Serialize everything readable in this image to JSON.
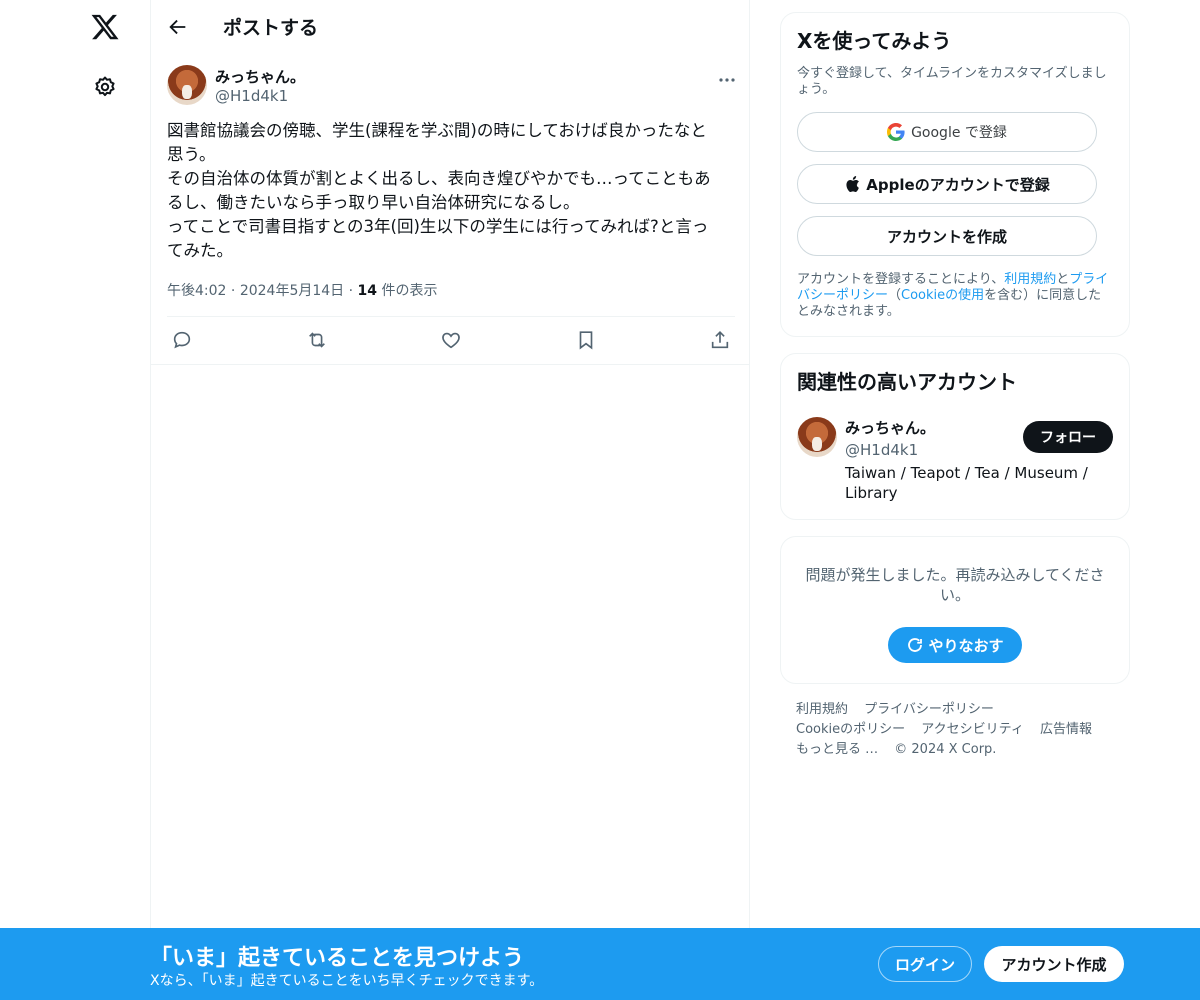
{
  "nav": {
    "logo": "x-logo",
    "settings_icon": "gear-icon"
  },
  "header": {
    "title": "ポストする"
  },
  "post": {
    "author_name": "みっちゃん。",
    "author_handle": "@H1d4k1",
    "text": "図書館協議会の傍聴、学生(課程を学ぶ間)の時にしておけば良かったなと\n思う。\nその自治体の体質が割とよく出るし、表向き煌びやかでも…ってこともあ\nるし、働きたいなら手っ取り早い自治体研究になるし。\nってことで司書目指すとの3年(回)生以下の学生には行ってみれば?と言っ\nてみた。",
    "time": "午後4:02",
    "date": "2024年5月14日",
    "views_count": "14",
    "views_label": "件の表示"
  },
  "signup_card": {
    "title": "Xを使ってみよう",
    "subtitle": "今すぐ登録して、タイムラインをカスタマイズしましょう。",
    "google_label": "Google で登録",
    "apple_label": "Appleのアカウントで登録",
    "create_label": "アカウントを作成",
    "legal_1": "アカウントを登録することにより、",
    "legal_terms": "利用規約",
    "legal_and": "と",
    "legal_privacy": "プライバシーポリシー",
    "legal_paren_open": "（",
    "legal_cookie": "Cookieの使用",
    "legal_2": "を含む）に同意したとみなされます。"
  },
  "related": {
    "title": "関連性の高いアカウント",
    "name": "みっちゃん。",
    "handle": "@H1d4k1",
    "bio": "Taiwan / Teapot / Tea / Museum / Library",
    "follow_label": "フォロー"
  },
  "error_card": {
    "message": "問題が発生しました。再読み込みしてください。",
    "retry_label": "やりなおす"
  },
  "footer": {
    "terms": "利用規約",
    "privacy": "プライバシーポリシー",
    "cookie": "Cookieのポリシー",
    "accessibility": "アクセシビリティ",
    "ads": "広告情報",
    "more": "もっと見る …",
    "copyright": "© 2024 X Corp."
  },
  "banner": {
    "title": "「いま」起きていることを見つけよう",
    "subtitle": "Xなら、「いま」起きていることをいち早くチェックできます。",
    "login_label": "ログイン",
    "signup_label": "アカウント作成"
  },
  "colors": {
    "accent": "#1d9bf0",
    "text": "#0f1419",
    "secondary": "#536471"
  }
}
